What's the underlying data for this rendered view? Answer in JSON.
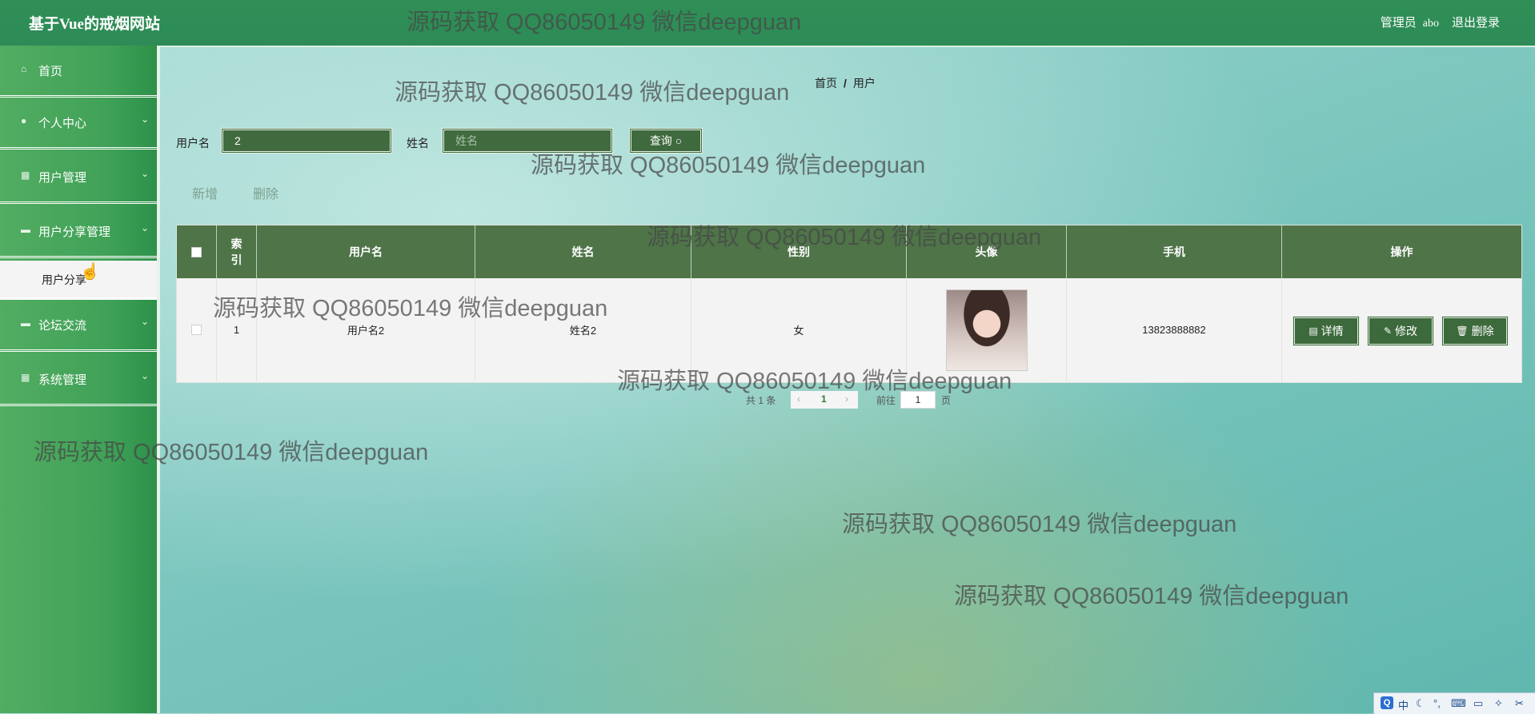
{
  "header": {
    "site_title": "基于Vue的戒烟网站",
    "user_role": "管理员",
    "user_name": "abo",
    "logout_label": "退出登录"
  },
  "sidebar": {
    "items": [
      {
        "label": "首页",
        "icon": "home-icon"
      },
      {
        "label": "个人中心",
        "icon": "user-icon"
      },
      {
        "label": "用户管理",
        "icon": "grid-icon"
      },
      {
        "label": "用户分享管理",
        "icon": "book-icon"
      },
      {
        "label": "论坛交流",
        "icon": "book-icon"
      },
      {
        "label": "系统管理",
        "icon": "grid-icon"
      }
    ],
    "submenu_item": "用户分享"
  },
  "breadcrumb": {
    "home": "首页",
    "separator": "/",
    "current": "用户"
  },
  "search": {
    "username_label": "用户名",
    "username_value": "2",
    "name_label": "姓名",
    "name_placeholder": "姓名",
    "query_label": "查询"
  },
  "actions": {
    "add_label": "新增",
    "delete_label": "删除"
  },
  "table": {
    "headers": [
      "索引",
      "用户名",
      "姓名",
      "性别",
      "头像",
      "手机",
      "操作"
    ],
    "rows": [
      {
        "index": "1",
        "username": "用户名2",
        "name": "姓名2",
        "gender": "女",
        "phone": "13823888882"
      }
    ],
    "row_buttons": {
      "detail": "详情",
      "edit": "修改",
      "delete": "删除"
    }
  },
  "pagination": {
    "total_prefix": "共",
    "total": "1",
    "total_suffix": "条",
    "current_page": "1",
    "goto_label": "前往",
    "goto_value": "1",
    "page_suffix": "页"
  },
  "watermark_text": "源码获取 QQ86050149 微信deepguan",
  "tray": {
    "ime": "中"
  },
  "colors": {
    "header": "#2e8b57",
    "sidebar": "#46a55c",
    "table_header": "#4e7448",
    "button": "#3d6a3c"
  }
}
